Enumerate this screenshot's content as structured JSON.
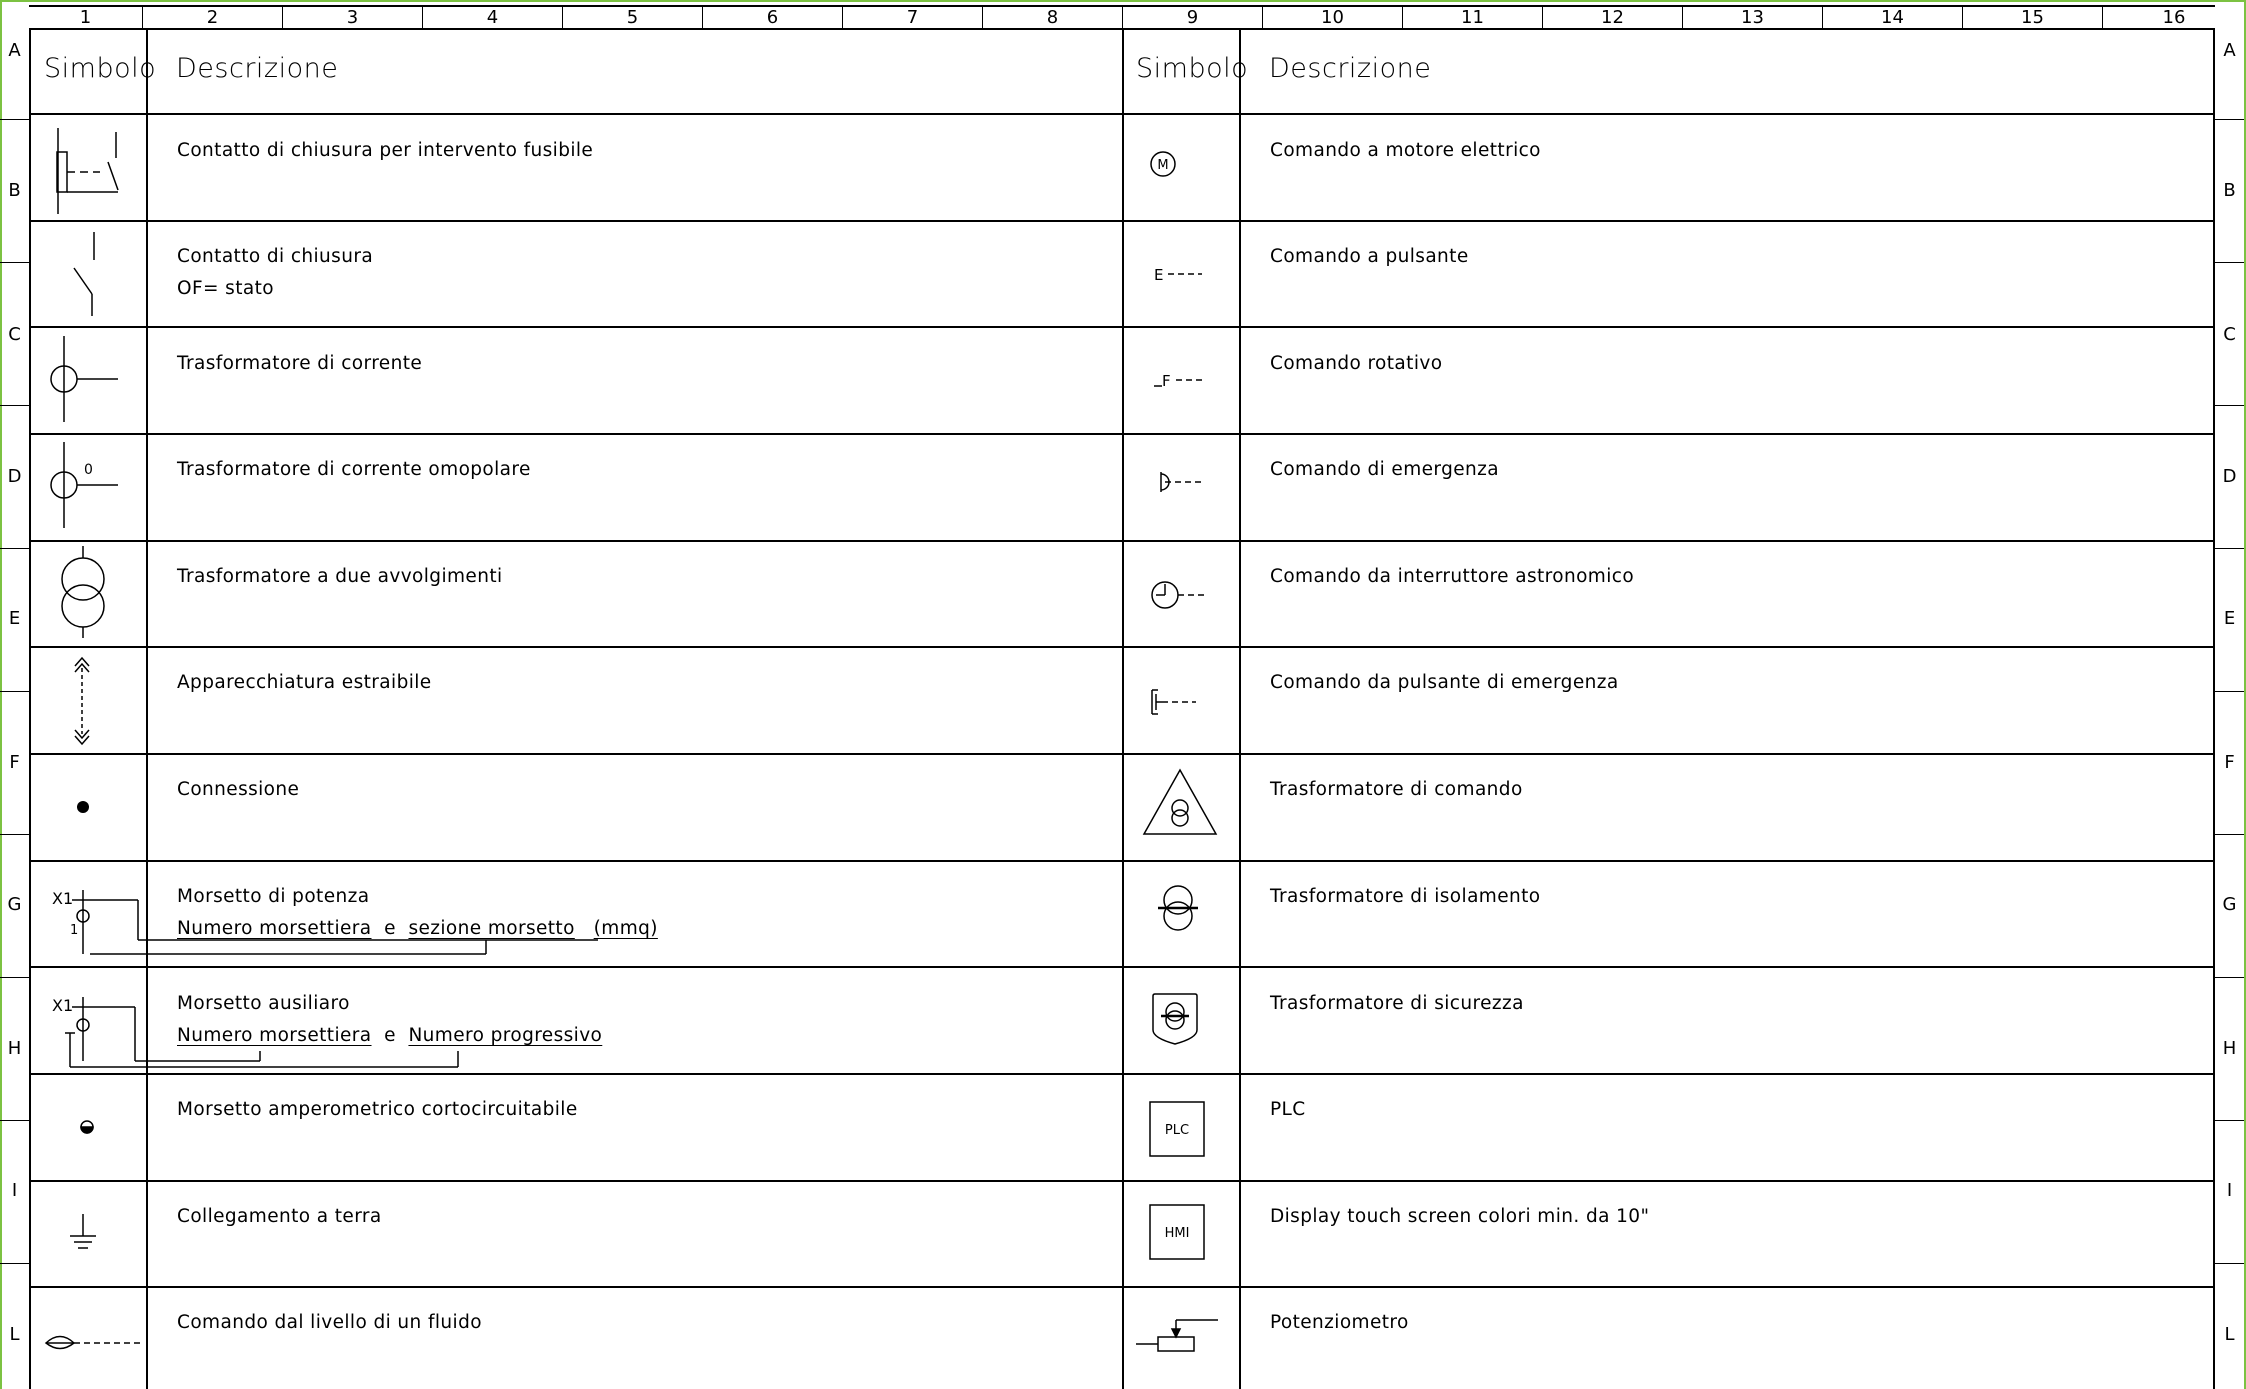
{
  "columns": [
    "1",
    "2",
    "3",
    "4",
    "5",
    "6",
    "7",
    "8",
    "9",
    "10",
    "11",
    "12",
    "13",
    "14",
    "15",
    "16"
  ],
  "rows": [
    "A",
    "B",
    "C",
    "D",
    "E",
    "F",
    "G",
    "H",
    "I",
    "L"
  ],
  "headers": {
    "left_symbol": "Simbolo",
    "left_description": "Descrizione",
    "right_symbol": "Simbolo",
    "right_description": "Descrizione"
  },
  "left_entries": [
    {
      "icon": "fuse-trip-contact-icon",
      "text": "Contatto di chiusura per intervento fusibile"
    },
    {
      "icon": "closing-contact-icon",
      "text": "Contatto di chiusura",
      "text2": "OF= stato"
    },
    {
      "icon": "current-transformer-icon",
      "text": "Trasformatore di corrente"
    },
    {
      "icon": "homopolar-current-transformer-icon",
      "label": "0",
      "text": "Trasformatore di corrente omopolare"
    },
    {
      "icon": "two-winding-transformer-icon",
      "text": "Trasformatore a due avvolgimenti"
    },
    {
      "icon": "withdrawable-equipment-icon",
      "text": "Apparecchiatura estraibile"
    },
    {
      "icon": "connection-dot-icon",
      "text": "Connessione"
    },
    {
      "icon": "power-terminal-icon",
      "label": "X1",
      "pin": "1",
      "text": "Morsetto di potenza",
      "sub_a": "Numero morsettiera",
      "sub_join": "e",
      "sub_b": "sezione morsetto",
      "sub_c": "(mmq)"
    },
    {
      "icon": "auxiliary-terminal-icon",
      "label": "X1",
      "text": "Morsetto ausiliaro",
      "sub_a": "Numero morsettiera",
      "sub_join": "e",
      "sub_b": "Numero progressivo"
    },
    {
      "icon": "shortable-ammeter-terminal-icon",
      "text": "Morsetto amperometrico cortocircuitabile"
    },
    {
      "icon": "earth-ground-icon",
      "text": "Collegamento a terra"
    },
    {
      "icon": "fluid-level-control-icon",
      "text": "Comando dal livello di un fluido"
    }
  ],
  "right_entries": [
    {
      "icon": "electric-motor-control-icon",
      "label": "M",
      "text": "Comando a motore elettrico"
    },
    {
      "icon": "push-button-control-icon",
      "label": "E",
      "text": "Comando a pulsante"
    },
    {
      "icon": "rotary-control-icon",
      "label": "F",
      "text": "Comando rotativo"
    },
    {
      "icon": "emergency-control-icon",
      "text": "Comando di emergenza"
    },
    {
      "icon": "astronomical-timer-control-icon",
      "text": "Comando da interruttore astronomico"
    },
    {
      "icon": "emergency-push-button-icon",
      "text": "Comando da pulsante di emergenza"
    },
    {
      "icon": "control-transformer-icon",
      "text": "Trasformatore di comando"
    },
    {
      "icon": "isolation-transformer-icon",
      "text": "Trasformatore di isolamento"
    },
    {
      "icon": "safety-transformer-icon",
      "text": "Trasformatore di sicurezza"
    },
    {
      "icon": "plc-box-icon",
      "label": "PLC",
      "text": "PLC"
    },
    {
      "icon": "hmi-box-icon",
      "label": "HMI",
      "text": "Display touch screen colori min. da 10\""
    },
    {
      "icon": "potentiometer-icon",
      "text": "Potenziometro"
    }
  ],
  "colors": {
    "sheet_border": "#7cc242",
    "lines": "#000000"
  }
}
